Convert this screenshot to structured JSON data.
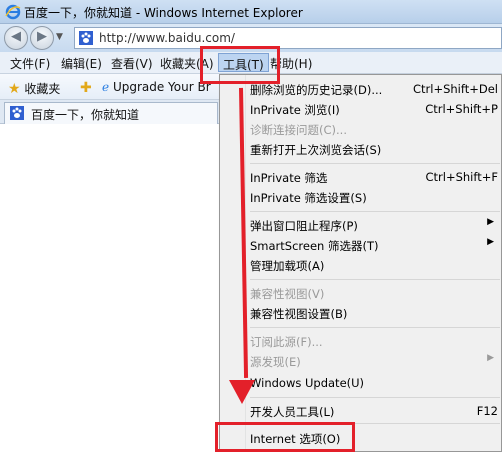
{
  "window": {
    "title": "百度一下，你就知道 - Windows Internet Explorer"
  },
  "address": {
    "url": "http://www.baidu.com/"
  },
  "menubar": {
    "items": [
      "文件(F)",
      "编辑(E)",
      "查看(V)",
      "收藏夹(A)",
      "工具(T)",
      "帮助(H)"
    ],
    "active_index": 4
  },
  "favbar": {
    "favorites_label": "收藏夹",
    "link_label": "Upgrade Your Br"
  },
  "tab": {
    "label": "百度一下，你就知道"
  },
  "tools_menu": {
    "items": [
      {
        "label": "删除浏览的历史记录(D)...",
        "shortcut": "Ctrl+Shift+Del",
        "enabled": true
      },
      {
        "label": "InPrivate 浏览(I)",
        "shortcut": "Ctrl+Shift+P",
        "enabled": true
      },
      {
        "label": "诊断连接问题(C)...",
        "shortcut": "",
        "enabled": false
      },
      {
        "label": "重新打开上次浏览会话(S)",
        "shortcut": "",
        "enabled": true
      },
      {
        "label": "InPrivate 筛选",
        "shortcut": "Ctrl+Shift+F",
        "enabled": true
      },
      {
        "label": "InPrivate 筛选设置(S)",
        "shortcut": "",
        "enabled": true
      },
      {
        "label": "弹出窗口阻止程序(P)",
        "shortcut": "",
        "enabled": true,
        "submenu": true
      },
      {
        "label": "SmartScreen 筛选器(T)",
        "shortcut": "",
        "enabled": true,
        "submenu": true
      },
      {
        "label": "管理加载项(A)",
        "shortcut": "",
        "enabled": true
      },
      {
        "label": "兼容性视图(V)",
        "shortcut": "",
        "enabled": false
      },
      {
        "label": "兼容性视图设置(B)",
        "shortcut": "",
        "enabled": true
      },
      {
        "label": "订阅此源(F)...",
        "shortcut": "",
        "enabled": false
      },
      {
        "label": "源发现(E)",
        "shortcut": "",
        "enabled": false,
        "submenu": true
      },
      {
        "label": "Windows Update(U)",
        "shortcut": "",
        "enabled": true
      },
      {
        "label": "开发人员工具(L)",
        "shortcut": "F12",
        "enabled": true
      },
      {
        "label": "Internet 选项(O)",
        "shortcut": "",
        "enabled": true
      }
    ]
  },
  "annotation": {
    "color": "#e3202a",
    "highlighted_menu": "工具(T)",
    "highlighted_item": "Internet 选项(O)"
  }
}
